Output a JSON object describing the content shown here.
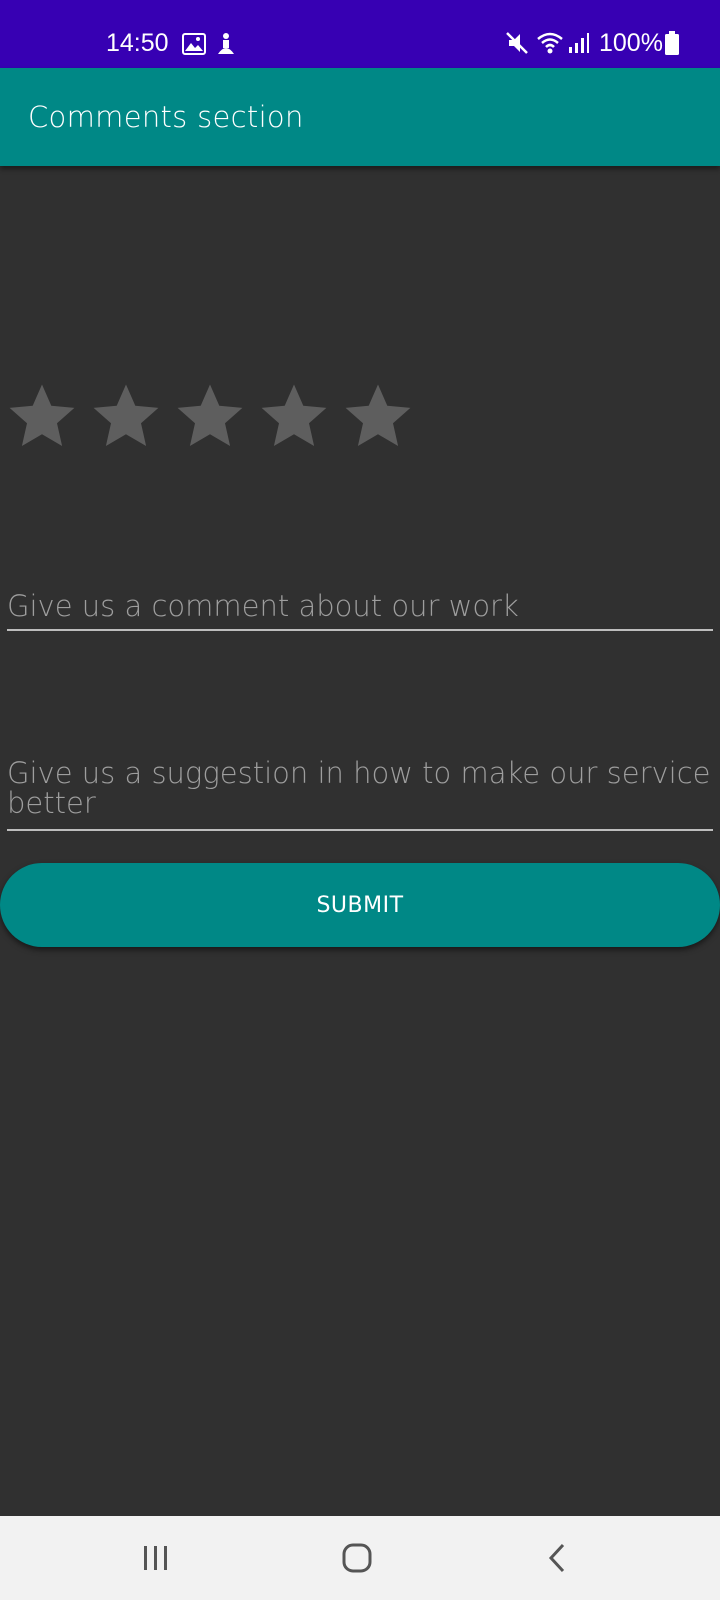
{
  "status_bar": {
    "time": "14:50",
    "battery": "100%",
    "icons": [
      "gallery-icon",
      "accessibility-icon",
      "mute-icon",
      "wifi-icon",
      "signal-icon",
      "battery-icon"
    ]
  },
  "app_bar": {
    "title": "Comments section"
  },
  "rating": {
    "max": 5,
    "value": 0,
    "star_color": "#5e5e5e"
  },
  "comment_field": {
    "placeholder": "Give us a comment about our work",
    "value": ""
  },
  "suggestion_field": {
    "placeholder": "Give us a suggestion in how to make our service better",
    "value": ""
  },
  "submit": {
    "label": "SUBMIT"
  },
  "nav_bar": {
    "icons": [
      "recents-icon",
      "home-icon",
      "back-icon"
    ]
  },
  "colors": {
    "status_bar": "#3700b3",
    "accent": "#008886",
    "background": "#303030",
    "nav_bar": "#f2f2f2"
  }
}
